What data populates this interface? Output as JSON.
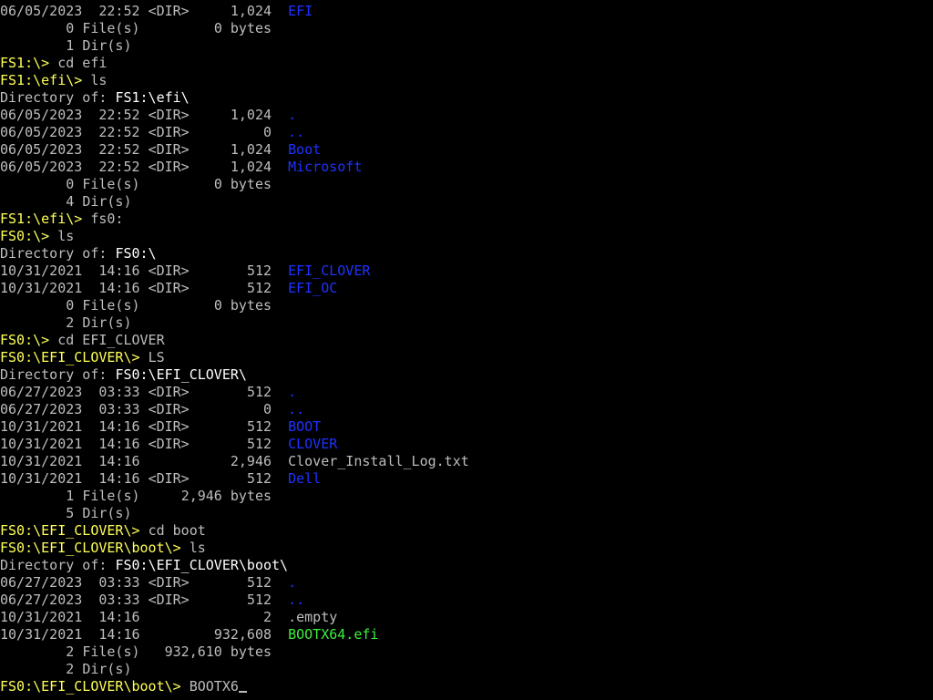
{
  "terminal": {
    "lines": [
      {
        "kind": "entry",
        "date": "06/05/2023",
        "time": "22:52",
        "dir": "<DIR>",
        "size": "1,024",
        "name": "EFI",
        "name_color": "blue"
      },
      {
        "kind": "summary",
        "count": "0",
        "label": "File(s)",
        "size": "0",
        "unit": "bytes"
      },
      {
        "kind": "summary",
        "count": "1",
        "label": "Dir(s)"
      },
      {
        "kind": "prompt",
        "prompt": "FS1:\\>",
        "command": "cd efi"
      },
      {
        "kind": "prompt",
        "prompt": "FS1:\\efi\\>",
        "command": "ls"
      },
      {
        "kind": "dirof",
        "label": "Directory of:",
        "path": "FS1:\\efi\\"
      },
      {
        "kind": "entry",
        "date": "06/05/2023",
        "time": "22:52",
        "dir": "<DIR>",
        "size": "1,024",
        "name": ".",
        "name_color": "blue"
      },
      {
        "kind": "entry",
        "date": "06/05/2023",
        "time": "22:52",
        "dir": "<DIR>",
        "size": "0",
        "name": "..",
        "name_color": "blue"
      },
      {
        "kind": "entry",
        "date": "06/05/2023",
        "time": "22:52",
        "dir": "<DIR>",
        "size": "1,024",
        "name": "Boot",
        "name_color": "blue"
      },
      {
        "kind": "entry",
        "date": "06/05/2023",
        "time": "22:52",
        "dir": "<DIR>",
        "size": "1,024",
        "name": "Microsoft",
        "name_color": "blue"
      },
      {
        "kind": "summary",
        "count": "0",
        "label": "File(s)",
        "size": "0",
        "unit": "bytes"
      },
      {
        "kind": "summary",
        "count": "4",
        "label": "Dir(s)"
      },
      {
        "kind": "prompt",
        "prompt": "FS1:\\efi\\>",
        "command": "fs0:"
      },
      {
        "kind": "prompt",
        "prompt": "FS0:\\>",
        "command": "ls"
      },
      {
        "kind": "dirof",
        "label": "Directory of:",
        "path": "FS0:\\"
      },
      {
        "kind": "entry",
        "date": "10/31/2021",
        "time": "14:16",
        "dir": "<DIR>",
        "size": "512",
        "name": "EFI_CLOVER",
        "name_color": "blue"
      },
      {
        "kind": "entry",
        "date": "10/31/2021",
        "time": "14:16",
        "dir": "<DIR>",
        "size": "512",
        "name": "EFI_OC",
        "name_color": "blue"
      },
      {
        "kind": "summary",
        "count": "0",
        "label": "File(s)",
        "size": "0",
        "unit": "bytes"
      },
      {
        "kind": "summary",
        "count": "2",
        "label": "Dir(s)"
      },
      {
        "kind": "prompt",
        "prompt": "FS0:\\>",
        "command": "cd EFI_CLOVER"
      },
      {
        "kind": "prompt",
        "prompt": "FS0:\\EFI_CLOVER\\>",
        "command": "LS"
      },
      {
        "kind": "dirof",
        "label": "Directory of:",
        "path": "FS0:\\EFI_CLOVER\\"
      },
      {
        "kind": "entry",
        "date": "06/27/2023",
        "time": "03:33",
        "dir": "<DIR>",
        "size": "512",
        "name": ".",
        "name_color": "blue"
      },
      {
        "kind": "entry",
        "date": "06/27/2023",
        "time": "03:33",
        "dir": "<DIR>",
        "size": "0",
        "name": "..",
        "name_color": "blue"
      },
      {
        "kind": "entry",
        "date": "10/31/2021",
        "time": "14:16",
        "dir": "<DIR>",
        "size": "512",
        "name": "BOOT",
        "name_color": "blue"
      },
      {
        "kind": "entry",
        "date": "10/31/2021",
        "time": "14:16",
        "dir": "<DIR>",
        "size": "512",
        "name": "CLOVER",
        "name_color": "blue"
      },
      {
        "kind": "entry",
        "date": "10/31/2021",
        "time": "14:16",
        "dir": "",
        "size": "2,946",
        "name": "Clover_Install_Log.txt",
        "name_color": "gray"
      },
      {
        "kind": "entry",
        "date": "10/31/2021",
        "time": "14:16",
        "dir": "<DIR>",
        "size": "512",
        "name": "Dell",
        "name_color": "blue"
      },
      {
        "kind": "summary",
        "count": "1",
        "label": "File(s)",
        "size": "2,946",
        "unit": "bytes"
      },
      {
        "kind": "summary",
        "count": "5",
        "label": "Dir(s)"
      },
      {
        "kind": "prompt",
        "prompt": "FS0:\\EFI_CLOVER\\>",
        "command": "cd boot"
      },
      {
        "kind": "prompt",
        "prompt": "FS0:\\EFI_CLOVER\\boot\\>",
        "command": "ls"
      },
      {
        "kind": "dirof",
        "label": "Directory of:",
        "path": "FS0:\\EFI_CLOVER\\boot\\"
      },
      {
        "kind": "entry",
        "date": "06/27/2023",
        "time": "03:33",
        "dir": "<DIR>",
        "size": "512",
        "name": ".",
        "name_color": "blue"
      },
      {
        "kind": "entry",
        "date": "06/27/2023",
        "time": "03:33",
        "dir": "<DIR>",
        "size": "512",
        "name": "..",
        "name_color": "blue"
      },
      {
        "kind": "entry",
        "date": "10/31/2021",
        "time": "14:16",
        "dir": "",
        "size": "2",
        "name": ".empty",
        "name_color": "gray"
      },
      {
        "kind": "entry",
        "date": "10/31/2021",
        "time": "14:16",
        "dir": "",
        "size": "932,608",
        "name": "BOOTX64.efi",
        "name_color": "green"
      },
      {
        "kind": "summary",
        "count": "2",
        "label": "File(s)",
        "size": "932,610",
        "unit": "bytes"
      },
      {
        "kind": "summary",
        "count": "2",
        "label": "Dir(s)"
      },
      {
        "kind": "input",
        "prompt": "FS0:\\EFI_CLOVER\\boot\\>",
        "command": "BOOTX6"
      }
    ]
  },
  "colors": {
    "background": "#000000",
    "text": "#bdbdbd",
    "prompt": "#ffff55",
    "path": "#ffffff",
    "directory": "#1f32ff",
    "executable": "#3cf03c"
  }
}
